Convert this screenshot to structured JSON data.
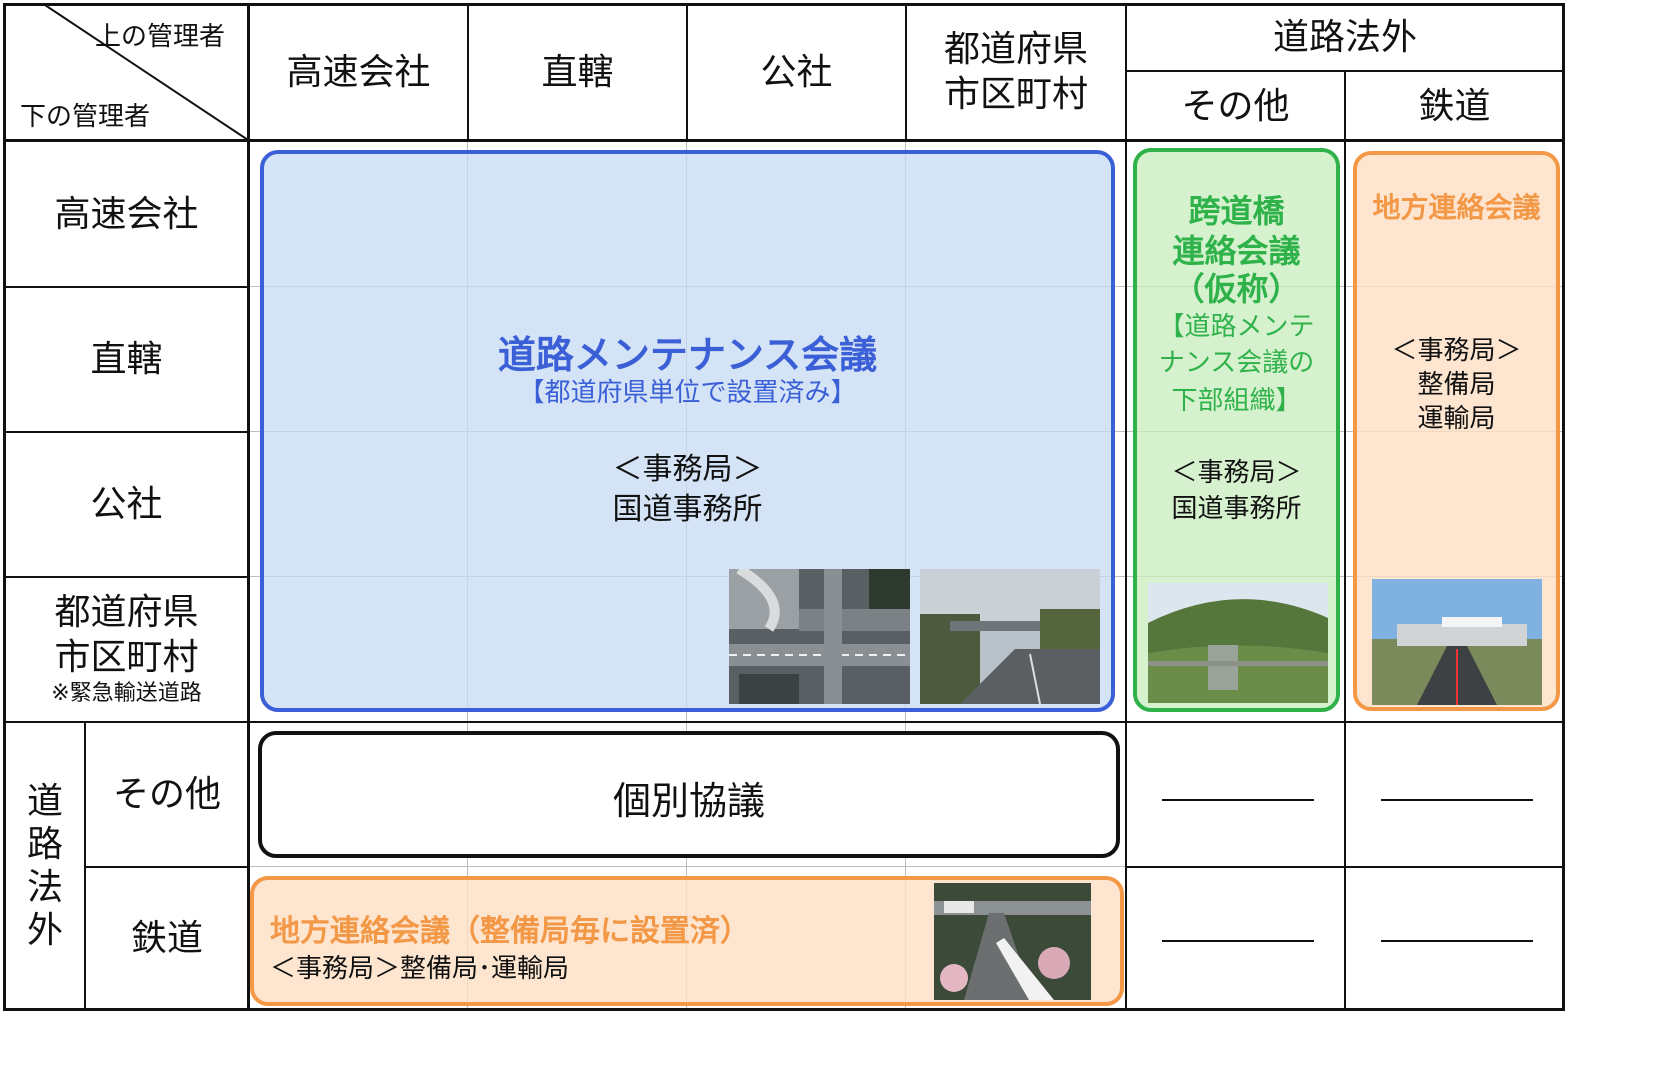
{
  "corner": {
    "top_label": "上の管理者",
    "bottom_label": "下の管理者"
  },
  "columns": {
    "c1": "高速会社",
    "c2": "直轄",
    "c3": "公社",
    "c4_line1": "都道府県",
    "c4_line2": "市区町村",
    "outside_group": "道路法外",
    "c5": "その他",
    "c6": "鉄道"
  },
  "rows": {
    "r1": "高速会社",
    "r2": "直轄",
    "r3": "公社",
    "r4_line1": "都道府県",
    "r4_line2": "市区町村",
    "r4_note": "※緊急輸送道路",
    "outside_group": [
      "道",
      "路",
      "法",
      "外"
    ],
    "r5": "その他",
    "r6": "鉄道"
  },
  "blocks": {
    "maintenance": {
      "title": "道路メンテナンス会議",
      "subtitle": "【都道府県単位で設置済み】",
      "office_label": "＜事務局＞",
      "office": "国道事務所"
    },
    "overpass": {
      "title_line1": "跨道橋",
      "title_line2": "連絡会議",
      "title_line3": "（仮称）",
      "sub_line1": "【道路メンテ",
      "sub_line2": "ナンス会議の",
      "sub_line3": "下部組織】",
      "office_label": "＜事務局＞",
      "office": "国道事務所"
    },
    "regional_right": {
      "title": "地方連絡会議",
      "office_label": "＜事務局＞",
      "office_line1": "整備局",
      "office_line2": "運輸局"
    },
    "individual": {
      "title": "個別協議"
    },
    "regional_bottom": {
      "title": "地方連絡会議（整備局毎に設置済）",
      "office": "＜事務局＞整備局･運輸局"
    }
  },
  "colors": {
    "blue_fill": "#c5d9f1",
    "blue_border": "#3a5fd6",
    "blue_text": "#3a5fd6",
    "green_fill": "#c8ecbe",
    "green_border": "#2fb24a",
    "green_text": "#2fb24a",
    "orange_fill": "#fcdec4",
    "orange_border": "#f39847",
    "orange_text": "#f39847"
  },
  "photos": [
    "urban-interchange-photo",
    "overpass-road-photo",
    "highway-bridge-photo",
    "railway-overpass-photo",
    "rail-track-photo"
  ]
}
